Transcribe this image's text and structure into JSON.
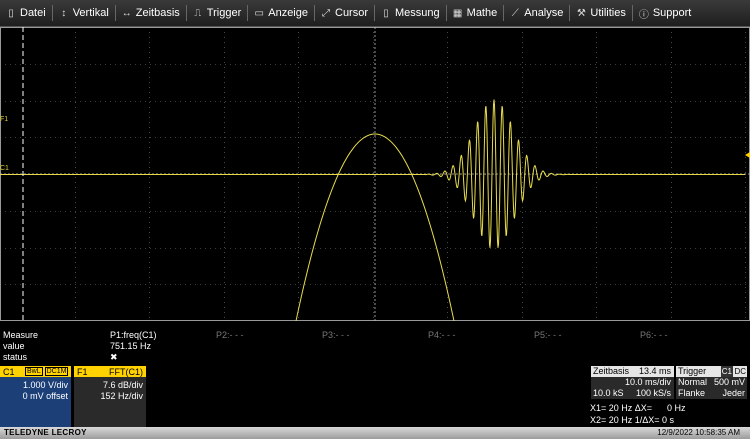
{
  "menu": {
    "items": [
      {
        "label": "Datei",
        "icon": "file-icon"
      },
      {
        "label": "Vertikal",
        "icon": "vertical-arrows-icon"
      },
      {
        "label": "Zeitbasis",
        "icon": "horizontal-arrows-icon"
      },
      {
        "label": "Trigger",
        "icon": "trigger-icon"
      },
      {
        "label": "Anzeige",
        "icon": "display-icon"
      },
      {
        "label": "Cursor",
        "icon": "cursor-icon"
      },
      {
        "label": "Messung",
        "icon": "measure-icon"
      },
      {
        "label": "Mathe",
        "icon": "math-icon"
      },
      {
        "label": "Analyse",
        "icon": "analysis-icon"
      },
      {
        "label": "Utilities",
        "icon": "utilities-icon"
      },
      {
        "label": "Support",
        "icon": "support-icon"
      }
    ]
  },
  "grid": {
    "marker_f1": "F1",
    "marker_c1": "C1"
  },
  "measure": {
    "row_labels": [
      "Measure",
      "value",
      "status"
    ],
    "params": [
      "P1:freq(C1)",
      "P2:- - -",
      "P3:- - -",
      "P4:- - -",
      "P5:- - -",
      "P6:- - -"
    ],
    "value": "751.15 Hz",
    "status": "✖"
  },
  "channel_c1": {
    "label": "C1",
    "badge1": "BwL",
    "badge2": "DC1M",
    "vdiv": "1.000 V/div",
    "offset": "0 mV offset"
  },
  "channel_f1": {
    "label": "F1",
    "func": "FFT(C1)",
    "scale": "7.6 dB/div",
    "center": "152 Hz/div"
  },
  "timebase": {
    "title": "Zeitbasis",
    "delay": "13.4 ms",
    "tdiv": "10.0 ms/div",
    "samples": "10.0 kS",
    "rate": "100 kS/s"
  },
  "trigger": {
    "title": "Trigger",
    "source": "C1",
    "coupling": "DC",
    "mode": "Normal",
    "level": "500 mV",
    "type": "Flanke",
    "slope": "Jeder"
  },
  "cursors": {
    "line1": "X1= 20 Hz ΔX=      0 Hz",
    "line2": "X2= 20 Hz 1/ΔX= 0 s"
  },
  "status": {
    "brand": "TELEDYNE LECROY",
    "datetime": "12/9/2022 10:58:35 AM"
  },
  "colors": {
    "trace": "#e8dc4c",
    "accent": "#ffd200",
    "c1_bg": "#1c3f78",
    "grid": "#7a7a7a"
  }
}
